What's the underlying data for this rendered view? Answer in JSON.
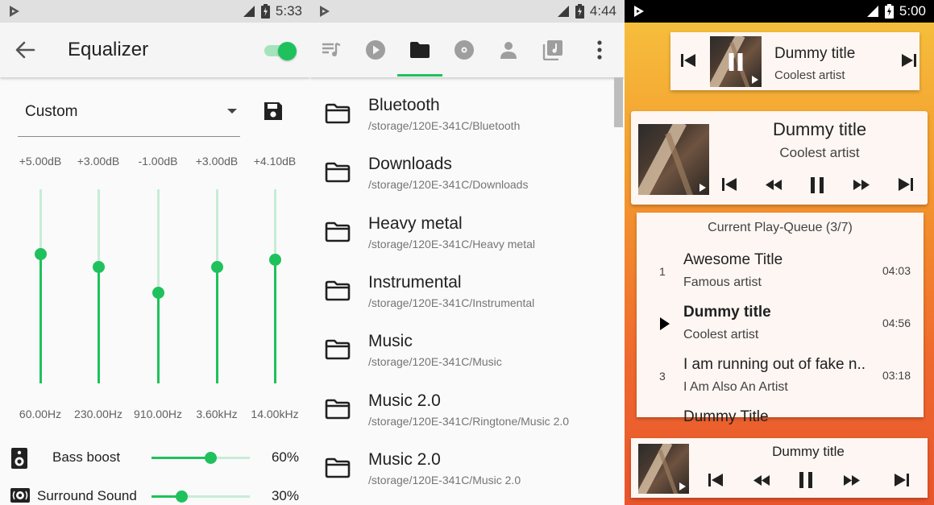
{
  "equalizer": {
    "status": {
      "time": "5:33"
    },
    "title": "Equalizer",
    "master_enabled": true,
    "preset": "Custom",
    "bands": [
      {
        "db": "+5.00dB",
        "freq": "60.00Hz",
        "level": 0.67
      },
      {
        "db": "+3.00dB",
        "freq": "230.00Hz",
        "level": 0.6
      },
      {
        "db": "-1.00dB",
        "freq": "910.00Hz",
        "level": 0.47
      },
      {
        "db": "+3.00dB",
        "freq": "3.60kHz",
        "level": 0.6
      },
      {
        "db": "+4.10dB",
        "freq": "14.00kHz",
        "level": 0.64
      }
    ],
    "bass_boost": {
      "label": "Bass boost",
      "value": "60%",
      "level": 0.6
    },
    "surround": {
      "label": "Surround Sound",
      "value": "30%",
      "level": 0.3
    },
    "colors": {
      "accent": "#1fc15c",
      "track": "#c8ecd6"
    }
  },
  "folders": {
    "status": {
      "time": "4:44"
    },
    "tabs": [
      "playlists-icon",
      "play-circle-icon",
      "folder-icon",
      "disc-icon",
      "artist-icon",
      "library-icon",
      "more-vert-icon"
    ],
    "active_tab": 2,
    "items": [
      {
        "name": "Bluetooth",
        "path": "/storage/120E-341C/Bluetooth"
      },
      {
        "name": "Downloads",
        "path": "/storage/120E-341C/Downloads"
      },
      {
        "name": "Heavy metal",
        "path": "/storage/120E-341C/Heavy metal"
      },
      {
        "name": "Instrumental",
        "path": "/storage/120E-341C/Instrumental"
      },
      {
        "name": "Music",
        "path": "/storage/120E-341C/Music"
      },
      {
        "name": "Music 2.0",
        "path": "/storage/120E-341C/Ringtone/Music 2.0"
      },
      {
        "name": "Music 2.0",
        "path": "/storage/120E-341C/Music 2.0"
      }
    ]
  },
  "widgets": {
    "status": {
      "time": "5:00"
    },
    "small": {
      "title": "Dummy title",
      "artist": "Coolest artist"
    },
    "medium": {
      "title": "Dummy title",
      "artist": "Coolest artist"
    },
    "queue": {
      "header": "Current Play-Queue (3/7)",
      "items": [
        {
          "num": "1",
          "title": "Awesome Title",
          "artist": "Famous artist",
          "duration": "04:03",
          "current": false
        },
        {
          "num": "",
          "title": "Dummy title",
          "artist": "Coolest artist",
          "duration": "04:56",
          "current": true
        },
        {
          "num": "3",
          "title": "I am running out of fake n..",
          "artist": "I Am Also An Artist",
          "duration": "03:18",
          "current": false
        },
        {
          "num": "",
          "title": "Dummy Title",
          "artist": "",
          "duration": "",
          "current": false
        }
      ]
    },
    "bottom": {
      "title": "Dummy title"
    }
  }
}
